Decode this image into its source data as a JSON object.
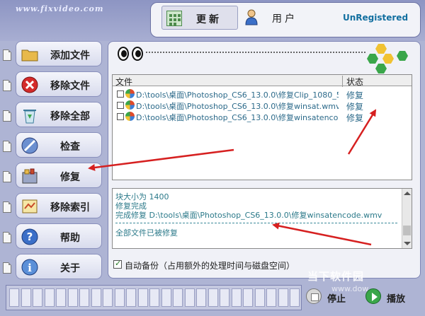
{
  "brand": "www.fixvideo.com",
  "header": {
    "tab_update": "更新",
    "tab_user": "用户",
    "registration": "UnRegistered"
  },
  "sidebar": {
    "items": [
      {
        "label": "添加文件",
        "icon": "folder-icon"
      },
      {
        "label": "移除文件",
        "icon": "remove-icon"
      },
      {
        "label": "移除全部",
        "icon": "recycle-bin-icon"
      },
      {
        "label": "检查",
        "icon": "check-icon"
      },
      {
        "label": "修复",
        "icon": "repair-icon"
      },
      {
        "label": "移除索引",
        "icon": "index-icon"
      },
      {
        "label": "帮助",
        "icon": "help-icon"
      },
      {
        "label": "关于",
        "icon": "info-icon"
      }
    ]
  },
  "file_table": {
    "headers": {
      "file": "文件",
      "status": "状态"
    },
    "rows": [
      {
        "file": "D:\\tools\\桌面\\Photoshop_CS6_13.0.0\\修复Clip_1080_5s...",
        "status": "修复"
      },
      {
        "file": "D:\\tools\\桌面\\Photoshop_CS6_13.0.0\\修复winsat.wmv",
        "status": "修复"
      },
      {
        "file": "D:\\tools\\桌面\\Photoshop_CS6_13.0.0\\修复winsatencode...",
        "status": "修复"
      }
    ]
  },
  "log": {
    "lines": [
      "块大小为 1400",
      "修复完成",
      "完成修复 D:\\tools\\桌面\\Photoshop_CS6_13.0.0\\修复winsatencode.wmv"
    ],
    "final": "全部文件已被修复"
  },
  "backup": {
    "label": "自动备份（占用额外的处理时间与磁盘空间）",
    "checked": true
  },
  "controls": {
    "stop": "停止",
    "play": "播放"
  },
  "watermark": {
    "text": "当下软件园",
    "url": "www.dow..."
  },
  "colors": {
    "accent_text": "#2c6a8a",
    "registration": "#126fa0",
    "arrow": "#d62020",
    "hex_green": "#3aa64a",
    "hex_yellow": "#f1c232"
  }
}
